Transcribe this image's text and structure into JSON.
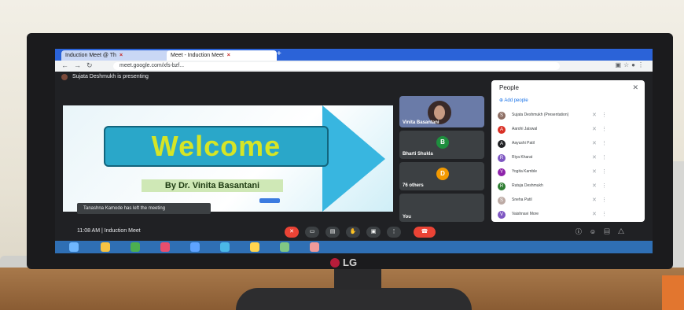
{
  "browser": {
    "tabs": [
      {
        "label": "Induction Meet @ Th",
        "icon": "calendar-icon"
      },
      {
        "label": "Meet - Induction Meet",
        "icon": "meet-icon"
      }
    ],
    "url": "meet.google.com/xfs-bzf...",
    "new_tab_glyph": "+"
  },
  "meeting": {
    "presenting_banner": "Sujata Deshmukh is presenting",
    "slide": {
      "title": "Welcome",
      "byline": "By Dr. Vinita Basantani"
    },
    "toast": "Tanashna Kamode has left the meeting",
    "tiles": [
      {
        "name": "Vinita Basantani",
        "initial": "",
        "color": "#6a7ba8"
      },
      {
        "name": "Bharti Shukla",
        "initial": "B",
        "color": "#1e8e3e"
      },
      {
        "name": "76 others",
        "initial": "D",
        "color": "#f29900"
      },
      {
        "name": "You",
        "initial": "",
        "color": "#5f6368"
      }
    ],
    "footer_time": "11:08 AM",
    "footer_sep": "|",
    "footer_title": "Induction Meet"
  },
  "people_panel": {
    "heading": "People",
    "add_label": "Add people",
    "rows": [
      {
        "name": "Sujata Deshmukh (Presentation)",
        "initial": "S",
        "color": "#8d6e63"
      },
      {
        "name": "Aarohi Jaiswal",
        "initial": "A",
        "color": "#d93025"
      },
      {
        "name": "Aayushi Patil",
        "initial": "A",
        "color": "#202124"
      },
      {
        "name": "Riya Kharat",
        "initial": "R",
        "color": "#7e57c2"
      },
      {
        "name": "Yogita Kamble",
        "initial": "Y",
        "color": "#8e24aa"
      },
      {
        "name": "Rutuja Deshmukh",
        "initial": "R",
        "color": "#2e7d32"
      },
      {
        "name": "Sneha Patil",
        "initial": "S",
        "color": "#bcaaa4"
      },
      {
        "name": "Vaishnavi More",
        "initial": "V",
        "color": "#7e57c2"
      }
    ]
  },
  "monitor": {
    "brand": "LG"
  }
}
